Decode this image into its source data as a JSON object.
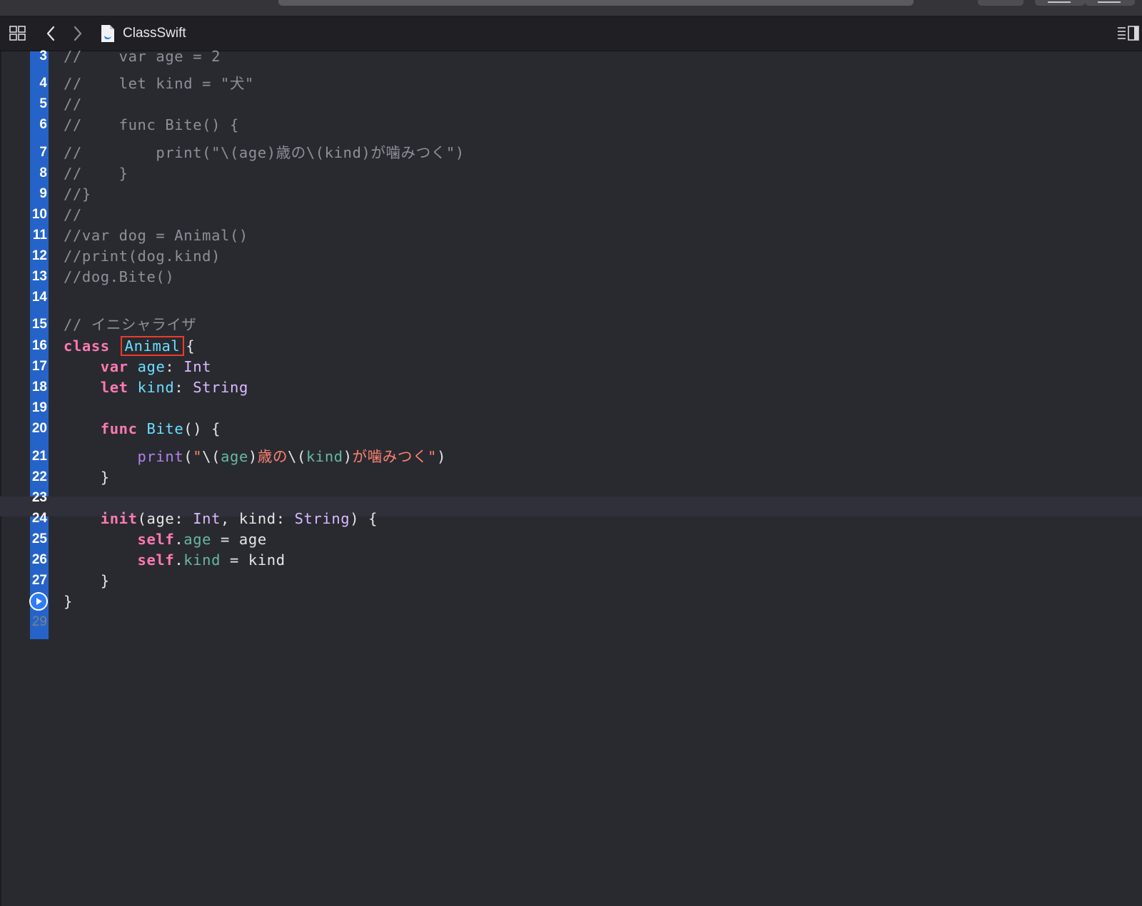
{
  "toolbar": {
    "file_title": "ClassSwift",
    "icons": [
      "related-items-grid-icon",
      "chevron-left-icon",
      "chevron-right-icon",
      "swift-file-icon",
      "inspector-toggle-icon"
    ]
  },
  "editor": {
    "lines": [
      {
        "n": "3",
        "tokens": [
          {
            "t": "//    var age = 2",
            "c": "comment"
          }
        ]
      },
      {
        "n": "4",
        "tokens": [
          {
            "t": "//    let kind = \"犬\"",
            "c": "comment"
          }
        ]
      },
      {
        "n": "5",
        "tokens": [
          {
            "t": "//",
            "c": "comment"
          }
        ]
      },
      {
        "n": "6",
        "tokens": [
          {
            "t": "//    func Bite() {",
            "c": "comment"
          }
        ]
      },
      {
        "n": "7",
        "tokens": [
          {
            "t": "//        print(\"\\(age)歳の\\(kind)が噛みつく\")",
            "c": "comment"
          }
        ]
      },
      {
        "n": "8",
        "tokens": [
          {
            "t": "//    }",
            "c": "comment"
          }
        ]
      },
      {
        "n": "9",
        "tokens": [
          {
            "t": "//}",
            "c": "comment"
          }
        ]
      },
      {
        "n": "10",
        "tokens": [
          {
            "t": "//",
            "c": "comment"
          }
        ]
      },
      {
        "n": "11",
        "tokens": [
          {
            "t": "//var dog = Animal()",
            "c": "comment"
          }
        ]
      },
      {
        "n": "12",
        "tokens": [
          {
            "t": "//print(dog.kind)",
            "c": "comment"
          }
        ]
      },
      {
        "n": "13",
        "tokens": [
          {
            "t": "//dog.Bite()",
            "c": "comment"
          }
        ]
      },
      {
        "n": "14",
        "tokens": []
      },
      {
        "n": "15",
        "tokens": [
          {
            "t": "// イニシャライザ",
            "c": "comment"
          }
        ]
      },
      {
        "n": "16",
        "tokens": [
          {
            "t": "class",
            "c": "kw"
          },
          {
            "t": " ",
            "c": "plain"
          },
          {
            "t": "Animal",
            "c": "class"
          },
          {
            "t": "{",
            "c": "plain"
          }
        ]
      },
      {
        "n": "17",
        "tokens": [
          {
            "t": "    ",
            "c": "plain"
          },
          {
            "t": "var",
            "c": "kw"
          },
          {
            "t": " ",
            "c": "plain"
          },
          {
            "t": "age",
            "c": "decl"
          },
          {
            "t": ": ",
            "c": "plain"
          },
          {
            "t": "Int",
            "c": "type"
          }
        ]
      },
      {
        "n": "18",
        "tokens": [
          {
            "t": "    ",
            "c": "plain"
          },
          {
            "t": "let",
            "c": "kw"
          },
          {
            "t": " ",
            "c": "plain"
          },
          {
            "t": "kind",
            "c": "decl"
          },
          {
            "t": ": ",
            "c": "plain"
          },
          {
            "t": "String",
            "c": "type"
          }
        ]
      },
      {
        "n": "19",
        "tokens": []
      },
      {
        "n": "20",
        "tokens": [
          {
            "t": "    ",
            "c": "plain"
          },
          {
            "t": "func",
            "c": "kw"
          },
          {
            "t": " ",
            "c": "plain"
          },
          {
            "t": "Bite",
            "c": "decl"
          },
          {
            "t": "() {",
            "c": "plain"
          }
        ]
      },
      {
        "n": "21",
        "tokens": [
          {
            "t": "        ",
            "c": "plain"
          },
          {
            "t": "print",
            "c": "func"
          },
          {
            "t": "(",
            "c": "plain"
          },
          {
            "t": "\"",
            "c": "str"
          },
          {
            "t": "\\(",
            "c": "plain"
          },
          {
            "t": "age",
            "c": "var"
          },
          {
            "t": ")",
            "c": "plain"
          },
          {
            "t": "歳の",
            "c": "str"
          },
          {
            "t": "\\(",
            "c": "plain"
          },
          {
            "t": "kind",
            "c": "var"
          },
          {
            "t": ")",
            "c": "plain"
          },
          {
            "t": "が噛みつく\"",
            "c": "str"
          },
          {
            "t": ")",
            "c": "plain"
          }
        ]
      },
      {
        "n": "22",
        "tokens": [
          {
            "t": "    }",
            "c": "plain"
          }
        ]
      },
      {
        "n": "23",
        "tokens": []
      },
      {
        "n": "24",
        "tokens": [
          {
            "t": "    ",
            "c": "plain"
          },
          {
            "t": "init",
            "c": "kw"
          },
          {
            "t": "(age: ",
            "c": "plain"
          },
          {
            "t": "Int",
            "c": "type"
          },
          {
            "t": ", kind: ",
            "c": "plain"
          },
          {
            "t": "String",
            "c": "type"
          },
          {
            "t": ") {",
            "c": "plain"
          }
        ]
      },
      {
        "n": "25",
        "tokens": [
          {
            "t": "        ",
            "c": "plain"
          },
          {
            "t": "self",
            "c": "kw"
          },
          {
            "t": ".",
            "c": "plain"
          },
          {
            "t": "age",
            "c": "var"
          },
          {
            "t": " = age",
            "c": "plain"
          }
        ]
      },
      {
        "n": "26",
        "tokens": [
          {
            "t": "        ",
            "c": "plain"
          },
          {
            "t": "self",
            "c": "kw"
          },
          {
            "t": ".",
            "c": "plain"
          },
          {
            "t": "kind",
            "c": "var"
          },
          {
            "t": " = kind",
            "c": "plain"
          }
        ]
      },
      {
        "n": "27",
        "tokens": [
          {
            "t": "    }",
            "c": "plain"
          }
        ]
      },
      {
        "n": "",
        "tokens": [
          {
            "t": "}",
            "c": "plain"
          }
        ],
        "run_button": true
      },
      {
        "n": "29",
        "tokens": [],
        "dim": true
      }
    ]
  }
}
